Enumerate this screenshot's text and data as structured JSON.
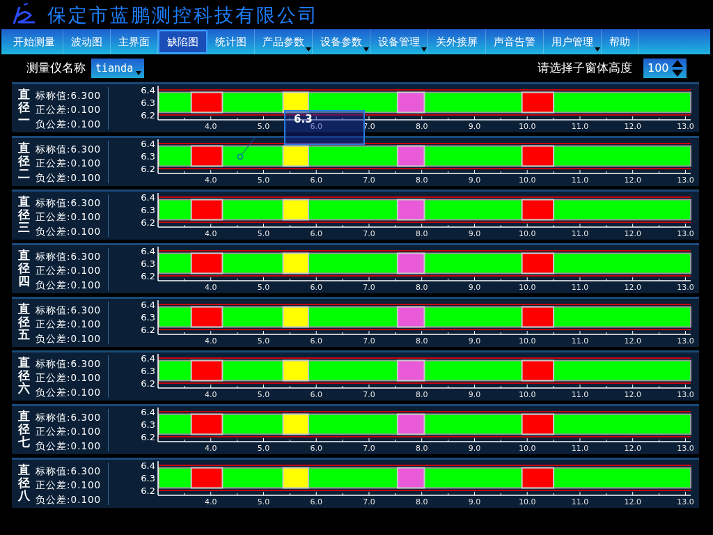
{
  "header": {
    "company": "保定市蓝鹏测控科技有限公司"
  },
  "menu": [
    {
      "label": "开始测量",
      "selected": false,
      "dropdown": false
    },
    {
      "label": "波动图",
      "selected": false,
      "dropdown": false
    },
    {
      "label": "主界面",
      "selected": false,
      "dropdown": false
    },
    {
      "label": "缺陷图",
      "selected": true,
      "dropdown": false
    },
    {
      "label": "统计图",
      "selected": false,
      "dropdown": false
    },
    {
      "label": "产品参数",
      "selected": false,
      "dropdown": true
    },
    {
      "label": "设备参数",
      "selected": false,
      "dropdown": true
    },
    {
      "label": "设备管理",
      "selected": false,
      "dropdown": true
    },
    {
      "label": "关外接屏",
      "selected": false,
      "dropdown": false
    },
    {
      "label": "声音告警",
      "selected": false,
      "dropdown": false
    },
    {
      "label": "用户管理",
      "selected": false,
      "dropdown": true
    },
    {
      "label": "帮助",
      "selected": false,
      "dropdown": false
    }
  ],
  "toolbar": {
    "instrument_label": "测量仪名称",
    "instrument_value": "tianda",
    "height_label": "请选择子窗体高度",
    "height_value": "100"
  },
  "tooltip": {
    "text": "6.3"
  },
  "panels": [
    {
      "name": "直径一",
      "nominal": "标称值:6.300",
      "upper": "正公差:0.100",
      "lower": "负公差:0.100",
      "chart_data": {
        "type": "bar",
        "xlim": [
          3.0,
          13.1
        ],
        "ylim": [
          6.2,
          6.4
        ],
        "yticks": [
          {
            "value": 6.2,
            "label": "6.2"
          },
          {
            "value": 6.3,
            "label": "6.3"
          },
          {
            "value": 6.4,
            "label": "6.4"
          }
        ],
        "xticks": [
          {
            "value": 4,
            "label": "4.0"
          },
          {
            "value": 5,
            "label": "5.0"
          },
          {
            "value": 6,
            "label": "6.0"
          },
          {
            "value": 7,
            "label": "7.0"
          },
          {
            "value": 8,
            "label": "8.0"
          },
          {
            "value": 9,
            "label": "9.0"
          },
          {
            "value": 10,
            "label": "10.0"
          },
          {
            "value": 11,
            "label": "11.0"
          },
          {
            "value": 12,
            "label": "12.0"
          },
          {
            "value": 13,
            "label": "13.0"
          }
        ],
        "ref_lines": [
          {
            "axis": "y",
            "value": 6.4,
            "color": "#ff0000"
          },
          {
            "axis": "y",
            "value": 6.2,
            "color": "#ff0000"
          }
        ],
        "bands": [
          {
            "axis": "y",
            "from": 6.22,
            "to": 6.38,
            "color": "#00ff00"
          },
          {
            "axis": "x",
            "from": 3.63,
            "to": 4.22,
            "color": "#ff0000"
          },
          {
            "axis": "x",
            "from": 5.37,
            "to": 5.85,
            "color": "#ffff00"
          },
          {
            "axis": "x",
            "from": 7.54,
            "to": 8.05,
            "color": "#e85ad8"
          },
          {
            "axis": "x",
            "from": 9.9,
            "to": 10.5,
            "color": "#ff0000"
          }
        ]
      }
    },
    {
      "name": "直径二",
      "nominal": "标称值:6.300",
      "upper": "正公差:0.100",
      "lower": "负公差:0.100",
      "chart_data": {
        "type": "bar",
        "xlim": [
          3.0,
          13.1
        ],
        "ylim": [
          6.2,
          6.4
        ],
        "yticks": [
          {
            "value": 6.2,
            "label": "6.2"
          },
          {
            "value": 6.3,
            "label": "6.3"
          },
          {
            "value": 6.4,
            "label": "6.4"
          }
        ],
        "xticks": [
          {
            "value": 4,
            "label": "4.0"
          },
          {
            "value": 5,
            "label": "5.0"
          },
          {
            "value": 6,
            "label": "6.0"
          },
          {
            "value": 7,
            "label": "7.0"
          },
          {
            "value": 8,
            "label": "8.0"
          },
          {
            "value": 9,
            "label": "9.0"
          },
          {
            "value": 10,
            "label": "10.0"
          },
          {
            "value": 11,
            "label": "11.0"
          },
          {
            "value": 12,
            "label": "12.0"
          },
          {
            "value": 13,
            "label": "13.0"
          }
        ],
        "ref_lines": [
          {
            "axis": "y",
            "value": 6.4,
            "color": "#ff0000"
          },
          {
            "axis": "y",
            "value": 6.2,
            "color": "#ff0000"
          }
        ],
        "bands": [
          {
            "axis": "y",
            "from": 6.22,
            "to": 6.38,
            "color": "#00ff00"
          },
          {
            "axis": "x",
            "from": 3.63,
            "to": 4.22,
            "color": "#ff0000"
          },
          {
            "axis": "x",
            "from": 5.37,
            "to": 5.85,
            "color": "#ffff00"
          },
          {
            "axis": "x",
            "from": 7.54,
            "to": 8.05,
            "color": "#e85ad8"
          },
          {
            "axis": "x",
            "from": 9.9,
            "to": 10.5,
            "color": "#ff0000"
          }
        ]
      }
    },
    {
      "name": "直径三",
      "nominal": "标称值:6.300",
      "upper": "正公差:0.100",
      "lower": "负公差:0.100",
      "chart_data": {
        "type": "bar",
        "xlim": [
          3.0,
          13.1
        ],
        "ylim": [
          6.2,
          6.4
        ],
        "yticks": [
          {
            "value": 6.2,
            "label": "6.2"
          },
          {
            "value": 6.3,
            "label": "6.3"
          },
          {
            "value": 6.4,
            "label": "6.4"
          }
        ],
        "xticks": [
          {
            "value": 4,
            "label": "4.0"
          },
          {
            "value": 5,
            "label": "5.0"
          },
          {
            "value": 6,
            "label": "6.0"
          },
          {
            "value": 7,
            "label": "7.0"
          },
          {
            "value": 8,
            "label": "8.0"
          },
          {
            "value": 9,
            "label": "9.0"
          },
          {
            "value": 10,
            "label": "10.0"
          },
          {
            "value": 11,
            "label": "11.0"
          },
          {
            "value": 12,
            "label": "12.0"
          },
          {
            "value": 13,
            "label": "13.0"
          }
        ],
        "ref_lines": [
          {
            "axis": "y",
            "value": 6.4,
            "color": "#ff0000"
          },
          {
            "axis": "y",
            "value": 6.2,
            "color": "#ff0000"
          }
        ],
        "bands": [
          {
            "axis": "y",
            "from": 6.22,
            "to": 6.38,
            "color": "#00ff00"
          },
          {
            "axis": "x",
            "from": 3.63,
            "to": 4.22,
            "color": "#ff0000"
          },
          {
            "axis": "x",
            "from": 5.37,
            "to": 5.85,
            "color": "#ffff00"
          },
          {
            "axis": "x",
            "from": 7.54,
            "to": 8.05,
            "color": "#e85ad8"
          },
          {
            "axis": "x",
            "from": 9.9,
            "to": 10.5,
            "color": "#ff0000"
          }
        ]
      }
    },
    {
      "name": "直径四",
      "nominal": "标称值:6.300",
      "upper": "正公差:0.100",
      "lower": "负公差:0.100",
      "chart_data": {
        "type": "bar",
        "xlim": [
          3.0,
          13.1
        ],
        "ylim": [
          6.2,
          6.4
        ],
        "yticks": [
          {
            "value": 6.2,
            "label": "6.2"
          },
          {
            "value": 6.3,
            "label": "6.3"
          },
          {
            "value": 6.4,
            "label": "6.4"
          }
        ],
        "xticks": [
          {
            "value": 4,
            "label": "4.0"
          },
          {
            "value": 5,
            "label": "5.0"
          },
          {
            "value": 6,
            "label": "6.0"
          },
          {
            "value": 7,
            "label": "7.0"
          },
          {
            "value": 8,
            "label": "8.0"
          },
          {
            "value": 9,
            "label": "9.0"
          },
          {
            "value": 10,
            "label": "10.0"
          },
          {
            "value": 11,
            "label": "11.0"
          },
          {
            "value": 12,
            "label": "12.0"
          },
          {
            "value": 13,
            "label": "13.0"
          }
        ],
        "ref_lines": [
          {
            "axis": "y",
            "value": 6.4,
            "color": "#ff0000"
          },
          {
            "axis": "y",
            "value": 6.2,
            "color": "#ff0000"
          }
        ],
        "bands": [
          {
            "axis": "y",
            "from": 6.22,
            "to": 6.38,
            "color": "#00ff00"
          },
          {
            "axis": "x",
            "from": 3.63,
            "to": 4.22,
            "color": "#ff0000"
          },
          {
            "axis": "x",
            "from": 5.37,
            "to": 5.85,
            "color": "#ffff00"
          },
          {
            "axis": "x",
            "from": 7.54,
            "to": 8.05,
            "color": "#e85ad8"
          },
          {
            "axis": "x",
            "from": 9.9,
            "to": 10.5,
            "color": "#ff0000"
          }
        ]
      }
    },
    {
      "name": "直径五",
      "nominal": "标称值:6.300",
      "upper": "正公差:0.100",
      "lower": "负公差:0.100",
      "chart_data": {
        "type": "bar",
        "xlim": [
          3.0,
          13.1
        ],
        "ylim": [
          6.2,
          6.4
        ],
        "yticks": [
          {
            "value": 6.2,
            "label": "6.2"
          },
          {
            "value": 6.3,
            "label": "6.3"
          },
          {
            "value": 6.4,
            "label": "6.4"
          }
        ],
        "xticks": [
          {
            "value": 4,
            "label": "4.0"
          },
          {
            "value": 5,
            "label": "5.0"
          },
          {
            "value": 6,
            "label": "6.0"
          },
          {
            "value": 7,
            "label": "7.0"
          },
          {
            "value": 8,
            "label": "8.0"
          },
          {
            "value": 9,
            "label": "9.0"
          },
          {
            "value": 10,
            "label": "10.0"
          },
          {
            "value": 11,
            "label": "11.0"
          },
          {
            "value": 12,
            "label": "12.0"
          },
          {
            "value": 13,
            "label": "13.0"
          }
        ],
        "ref_lines": [
          {
            "axis": "y",
            "value": 6.4,
            "color": "#ff0000"
          },
          {
            "axis": "y",
            "value": 6.2,
            "color": "#ff0000"
          }
        ],
        "bands": [
          {
            "axis": "y",
            "from": 6.22,
            "to": 6.38,
            "color": "#00ff00"
          },
          {
            "axis": "x",
            "from": 3.63,
            "to": 4.22,
            "color": "#ff0000"
          },
          {
            "axis": "x",
            "from": 5.37,
            "to": 5.85,
            "color": "#ffff00"
          },
          {
            "axis": "x",
            "from": 7.54,
            "to": 8.05,
            "color": "#e85ad8"
          },
          {
            "axis": "x",
            "from": 9.9,
            "to": 10.5,
            "color": "#ff0000"
          }
        ]
      }
    },
    {
      "name": "直径六",
      "nominal": "标称值:6.300",
      "upper": "正公差:0.100",
      "lower": "负公差:0.100",
      "chart_data": {
        "type": "bar",
        "xlim": [
          3.0,
          13.1
        ],
        "ylim": [
          6.2,
          6.4
        ],
        "yticks": [
          {
            "value": 6.2,
            "label": "6.2"
          },
          {
            "value": 6.3,
            "label": "6.3"
          },
          {
            "value": 6.4,
            "label": "6.4"
          }
        ],
        "xticks": [
          {
            "value": 4,
            "label": "4.0"
          },
          {
            "value": 5,
            "label": "5.0"
          },
          {
            "value": 6,
            "label": "6.0"
          },
          {
            "value": 7,
            "label": "7.0"
          },
          {
            "value": 8,
            "label": "8.0"
          },
          {
            "value": 9,
            "label": "9.0"
          },
          {
            "value": 10,
            "label": "10.0"
          },
          {
            "value": 11,
            "label": "11.0"
          },
          {
            "value": 12,
            "label": "12.0"
          },
          {
            "value": 13,
            "label": "13.0"
          }
        ],
        "ref_lines": [
          {
            "axis": "y",
            "value": 6.4,
            "color": "#ff0000"
          },
          {
            "axis": "y",
            "value": 6.2,
            "color": "#ff0000"
          }
        ],
        "bands": [
          {
            "axis": "y",
            "from": 6.22,
            "to": 6.38,
            "color": "#00ff00"
          },
          {
            "axis": "x",
            "from": 3.63,
            "to": 4.22,
            "color": "#ff0000"
          },
          {
            "axis": "x",
            "from": 5.37,
            "to": 5.85,
            "color": "#ffff00"
          },
          {
            "axis": "x",
            "from": 7.54,
            "to": 8.05,
            "color": "#e85ad8"
          },
          {
            "axis": "x",
            "from": 9.9,
            "to": 10.5,
            "color": "#ff0000"
          }
        ]
      }
    },
    {
      "name": "直径七",
      "nominal": "标称值:6.300",
      "upper": "正公差:0.100",
      "lower": "负公差:0.100",
      "chart_data": {
        "type": "bar",
        "xlim": [
          3.0,
          13.1
        ],
        "ylim": [
          6.2,
          6.4
        ],
        "yticks": [
          {
            "value": 6.2,
            "label": "6.2"
          },
          {
            "value": 6.3,
            "label": "6.3"
          },
          {
            "value": 6.4,
            "label": "6.4"
          }
        ],
        "xticks": [
          {
            "value": 4,
            "label": "4.0"
          },
          {
            "value": 5,
            "label": "5.0"
          },
          {
            "value": 6,
            "label": "6.0"
          },
          {
            "value": 7,
            "label": "7.0"
          },
          {
            "value": 8,
            "label": "8.0"
          },
          {
            "value": 9,
            "label": "9.0"
          },
          {
            "value": 10,
            "label": "10.0"
          },
          {
            "value": 11,
            "label": "11.0"
          },
          {
            "value": 12,
            "label": "12.0"
          },
          {
            "value": 13,
            "label": "13.0"
          }
        ],
        "ref_lines": [
          {
            "axis": "y",
            "value": 6.4,
            "color": "#ff0000"
          },
          {
            "axis": "y",
            "value": 6.2,
            "color": "#ff0000"
          }
        ],
        "bands": [
          {
            "axis": "y",
            "from": 6.22,
            "to": 6.38,
            "color": "#00ff00"
          },
          {
            "axis": "x",
            "from": 3.63,
            "to": 4.22,
            "color": "#ff0000"
          },
          {
            "axis": "x",
            "from": 5.37,
            "to": 5.85,
            "color": "#ffff00"
          },
          {
            "axis": "x",
            "from": 7.54,
            "to": 8.05,
            "color": "#e85ad8"
          },
          {
            "axis": "x",
            "from": 9.9,
            "to": 10.5,
            "color": "#ff0000"
          }
        ]
      }
    },
    {
      "name": "直径八",
      "nominal": "标称值:6.300",
      "upper": "正公差:0.100",
      "lower": "负公差:0.100",
      "chart_data": {
        "type": "bar",
        "xlim": [
          3.0,
          13.1
        ],
        "ylim": [
          6.2,
          6.4
        ],
        "yticks": [
          {
            "value": 6.2,
            "label": "6.2"
          },
          {
            "value": 6.3,
            "label": "6.3"
          },
          {
            "value": 6.4,
            "label": "6.4"
          }
        ],
        "xticks": [
          {
            "value": 4,
            "label": "4.0"
          },
          {
            "value": 5,
            "label": "5.0"
          },
          {
            "value": 6,
            "label": "6.0"
          },
          {
            "value": 7,
            "label": "7.0"
          },
          {
            "value": 8,
            "label": "8.0"
          },
          {
            "value": 9,
            "label": "9.0"
          },
          {
            "value": 10,
            "label": "10.0"
          },
          {
            "value": 11,
            "label": "11.0"
          },
          {
            "value": 12,
            "label": "12.0"
          },
          {
            "value": 13,
            "label": "13.0"
          }
        ],
        "ref_lines": [
          {
            "axis": "y",
            "value": 6.4,
            "color": "#ff0000"
          },
          {
            "axis": "y",
            "value": 6.2,
            "color": "#ff0000"
          }
        ],
        "bands": [
          {
            "axis": "y",
            "from": 6.22,
            "to": 6.38,
            "color": "#00ff00"
          },
          {
            "axis": "x",
            "from": 3.63,
            "to": 4.22,
            "color": "#ff0000"
          },
          {
            "axis": "x",
            "from": 5.37,
            "to": 5.85,
            "color": "#ffff00"
          },
          {
            "axis": "x",
            "from": 7.54,
            "to": 8.05,
            "color": "#e85ad8"
          },
          {
            "axis": "x",
            "from": 9.9,
            "to": 10.5,
            "color": "#ff0000"
          }
        ]
      }
    }
  ]
}
